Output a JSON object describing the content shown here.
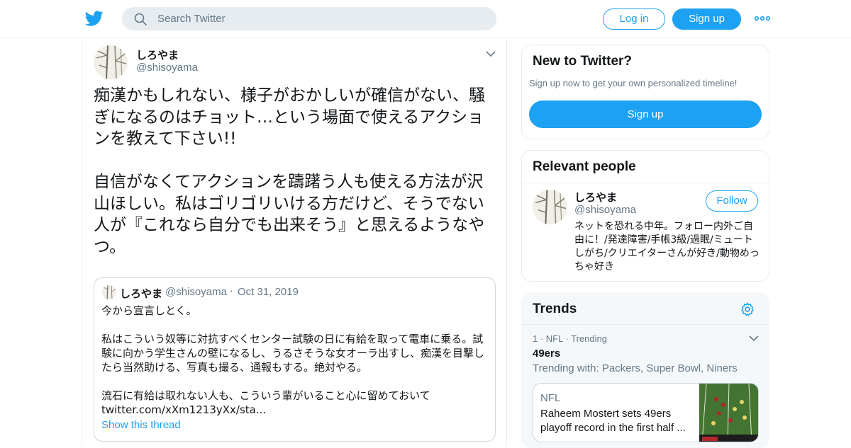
{
  "topbar": {
    "search_placeholder": "Search Twitter",
    "login_label": "Log in",
    "signup_label": "Sign up"
  },
  "tweet": {
    "author_name": "しろやま",
    "author_handle": "@shisoyama",
    "text": "痴漢かもしれない、様子がおかしいが確信がない、騒ぎになるのはチョット…という場面で使えるアクションを教えて下さい!!\n\n自信がなくてアクションを躊躇う人も使える方法が沢山ほしい。私はゴリゴリいける方だけど、そうでない人が『これなら自分でも出来そう』と思えるようなやつ。",
    "quote": {
      "author_name": "しろやま",
      "author_handle": "@shisoyama",
      "separator": "·",
      "date": "Oct 31, 2019",
      "text": "今から宣言しとく。\n\n私はこういう奴等に対抗すべくセンター試験の日に有給を取って電車に乗る。試験に向かう学生さんの壁になるし、うるさそうな女オーラ出すし、痴漢を目撃したら当然助ける、写真も撮る、通報もする。絶対やる。\n\n流石に有給は取れない人も、こういう輩がいること心に留めておいて\ntwitter.com/xXm1213yXx/sta...",
      "show_thread": "Show this thread"
    }
  },
  "sidebar": {
    "new_to_twitter": {
      "title": "New to Twitter?",
      "description": "Sign up now to get your own personalized timeline!",
      "signup_label": "Sign up"
    },
    "relevant_people": {
      "title": "Relevant people",
      "name": "しろやま",
      "handle": "@shisoyama",
      "follow_label": "Follow",
      "bio": "ネットを恐れる中年。フォロー内外ご自由に！/発達障害/手帳3級/過眠/ミュートしがち/クリエイターさんが好き/動物めっちゃ好き"
    },
    "trends": {
      "title": "Trends",
      "item": {
        "meta": "1 · NFL · Trending",
        "name": "49ers",
        "with": "Trending with: Packers, Super Bowl, Niners",
        "news_category": "NFL",
        "news_headline": "Raheem Mostert sets 49ers playoff record in the first half ..."
      }
    }
  },
  "colors": {
    "accent": "#1da1f2",
    "text": "#14171a",
    "muted": "#657786",
    "border": "#e6ecf0"
  }
}
